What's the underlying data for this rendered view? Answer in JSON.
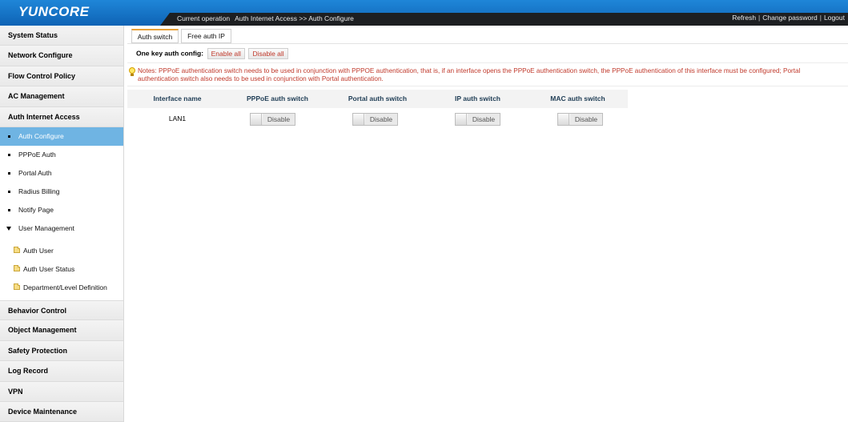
{
  "header": {
    "logo": "YUNCORE",
    "current_operation_label": "Current operation",
    "current_operation_path": "Auth Internet Access >> Auth Configure",
    "links": [
      "Refresh",
      "Change password",
      "Logout"
    ],
    "colors": {
      "header_blue": "#1473c8",
      "op_bar": "#1d1f22"
    }
  },
  "sidebar": {
    "top_items": [
      "System Status",
      "Network Configure",
      "Flow Control Policy",
      "AC Management",
      "Auth Internet Access"
    ],
    "sub_items": [
      "Auth Configure",
      "PPPoE Auth",
      "Portal Auth",
      "Radius Billing",
      "Notify Page",
      "User Management"
    ],
    "active_sub_item": "Auth Configure",
    "leaf_items": [
      "Auth User",
      "Auth User Status",
      "Department/Level Definition"
    ],
    "bottom_items": [
      "Behavior Control",
      "Object Management",
      "Safety Protection",
      "Log Record",
      "VPN",
      "Device Maintenance"
    ],
    "active_color": "#6fb4e3"
  },
  "tabs": [
    "Auth switch",
    "Free auth IP"
  ],
  "active_tab": "Auth switch",
  "one_key": {
    "label": "One key auth config:",
    "enable_all": "Enable all",
    "disable_all": "Disable all"
  },
  "notes": "Notes: PPPoE authentication switch needs to be used in conjunction with PPPOE authentication, that is, if an interface opens the PPPoE authentication switch, the PPPoE authentication of this interface must be configured; Portal authentication switch also needs to be used in conjunction with Portal authentication.",
  "notes_color": "#c0392b",
  "table": {
    "headers": [
      "Interface name",
      "PPPoE auth switch",
      "Portal auth switch",
      "IP auth switch",
      "MAC auth switch"
    ],
    "rows": [
      {
        "interface": "LAN1",
        "pppoe": "Disable",
        "portal": "Disable",
        "ip": "Disable",
        "mac": "Disable"
      }
    ]
  }
}
